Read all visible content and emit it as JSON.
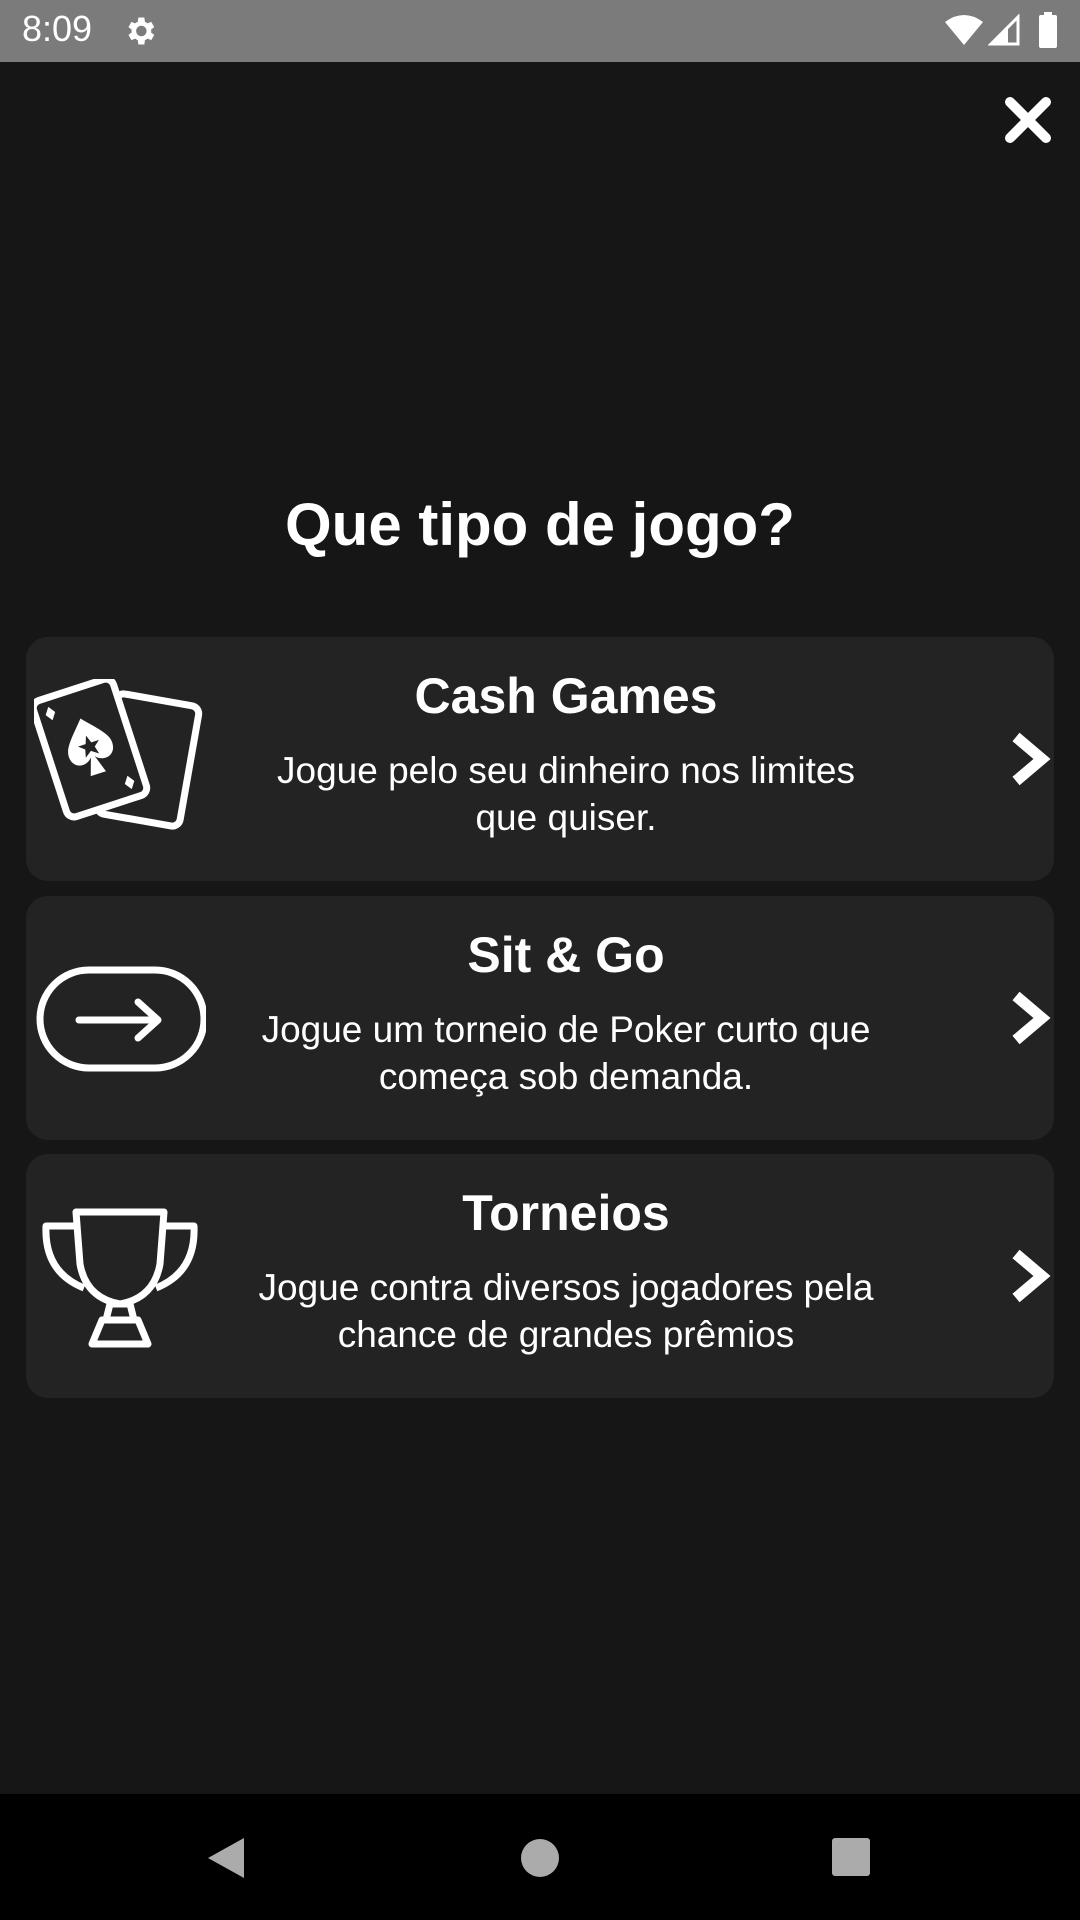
{
  "status_bar": {
    "time": "8:09",
    "icons": [
      "gear-icon",
      "wifi-icon",
      "signal-icon",
      "battery-icon"
    ]
  },
  "header": {
    "close_icon": "close-icon"
  },
  "main": {
    "title": "Que tipo de jogo?",
    "options": [
      {
        "icon": "playing-cards-icon",
        "title": "Cash Games",
        "description_line1": "Jogue pelo seu dinheiro nos limites",
        "description_line2": "que quiser."
      },
      {
        "icon": "arrow-right-pill-icon",
        "title": "Sit & Go",
        "description_line1": "Jogue um torneio de Poker curto que",
        "description_line2": "começa sob demanda."
      },
      {
        "icon": "trophy-icon",
        "title": "Torneios",
        "description_line1": "Jogue contra diversos jogadores pela",
        "description_line2": "chance de grandes prêmios"
      }
    ]
  },
  "nav_bar": {
    "icons": [
      "back-icon",
      "home-icon",
      "recents-icon"
    ]
  },
  "colors": {
    "background": "#161616",
    "card": "#232323",
    "status_bar": "#7b7b7b",
    "text": "#ffffff",
    "nav_bar": "#000000"
  }
}
